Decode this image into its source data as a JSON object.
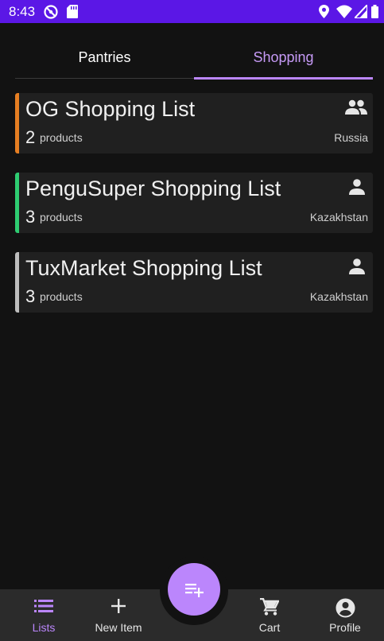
{
  "status_bar": {
    "time": "8:43",
    "icons": [
      "no-disturb-icon",
      "sd-card-icon",
      "location-icon",
      "wifi-icon",
      "signal-icon",
      "battery-icon"
    ],
    "color": "#5b17e6"
  },
  "tabs": [
    {
      "label": "Pantries",
      "selected": false
    },
    {
      "label": "Shopping",
      "selected": true
    }
  ],
  "lists": [
    {
      "title": "OG Shopping List",
      "count": "2",
      "count_label": "products",
      "country": "Russia",
      "accent": "#e67e22",
      "share_icon": "group-icon"
    },
    {
      "title": "PenguSuper Shopping List",
      "count": "3",
      "count_label": "products",
      "country": "Kazakhstan",
      "accent": "#2ecc71",
      "share_icon": "person-icon"
    },
    {
      "title": "TuxMarket Shopping List",
      "count": "3",
      "count_label": "products",
      "country": "Kazakhstan",
      "accent": "#bdbdbd",
      "share_icon": "person-icon"
    }
  ],
  "fab": {
    "icon": "playlist-add-icon",
    "color": "#bb86fc"
  },
  "bottom_nav": [
    {
      "label": "Lists",
      "icon": "list-icon",
      "selected": true
    },
    {
      "label": "New Item",
      "icon": "plus-icon",
      "selected": false
    },
    {
      "label": "Cart",
      "icon": "cart-icon",
      "selected": false
    },
    {
      "label": "Profile",
      "icon": "account-circle-icon",
      "selected": false
    }
  ]
}
